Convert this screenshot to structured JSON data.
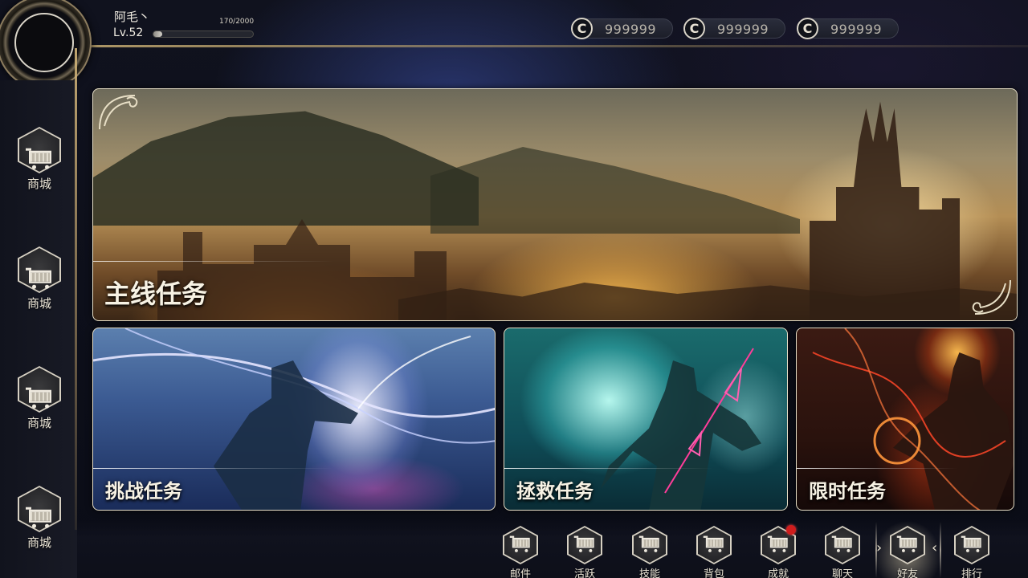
{
  "player": {
    "name": "阿毛丶",
    "level": "Lv.52",
    "exp_text": "170/2000",
    "exp_fraction": 0.085
  },
  "currencies": [
    {
      "symbol": "C",
      "amount": "999999"
    },
    {
      "symbol": "C",
      "amount": "999999"
    },
    {
      "symbol": "C",
      "amount": "999999"
    }
  ],
  "sidebar": {
    "items": [
      {
        "label": "商城",
        "icon": "shopping-cart-icon"
      },
      {
        "label": "商城",
        "icon": "shopping-cart-icon"
      },
      {
        "label": "商城",
        "icon": "shopping-cart-icon"
      },
      {
        "label": "商城",
        "icon": "shopping-cart-icon"
      }
    ]
  },
  "quests": {
    "main": "主线任务",
    "challenge": "挑战任务",
    "rescue": "拯救任务",
    "limited": "限时任务"
  },
  "bottom_nav": {
    "items": [
      {
        "label": "邮件",
        "icon": "shopping-cart-icon"
      },
      {
        "label": "活跃",
        "icon": "shopping-cart-icon"
      },
      {
        "label": "技能",
        "icon": "shopping-cart-icon"
      },
      {
        "label": "背包",
        "icon": "shopping-cart-icon"
      },
      {
        "label": "成就",
        "icon": "shopping-cart-icon",
        "badge": true
      },
      {
        "label": "聊天",
        "icon": "shopping-cart-icon"
      },
      {
        "label": "好友",
        "icon": "shopping-cart-icon",
        "active": true
      },
      {
        "label": "排行",
        "icon": "shopping-cart-icon"
      }
    ]
  },
  "colors": {
    "frame_gold": "#bfa56e",
    "background": "#0b0d17",
    "badge_red": "#d01d1d"
  }
}
